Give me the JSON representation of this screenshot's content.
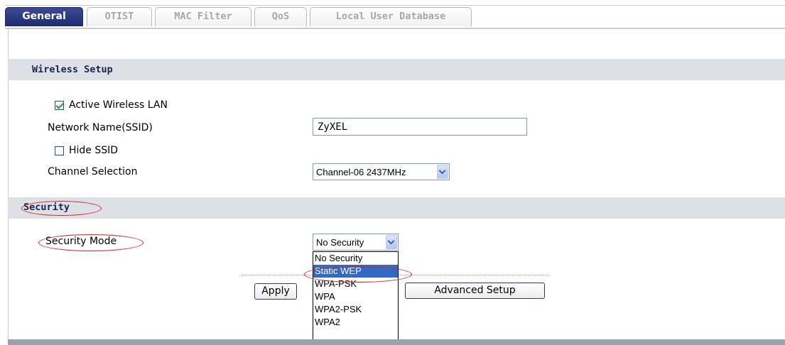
{
  "tabs": [
    {
      "label": "General",
      "active": true
    },
    {
      "label": "OTIST",
      "active": false
    },
    {
      "label": "MAC Filter",
      "active": false
    },
    {
      "label": "QoS",
      "active": false
    },
    {
      "label": "Local User Database",
      "active": false
    }
  ],
  "wireless_setup": {
    "title": "Wireless Setup",
    "active_wlan": {
      "label": "Active Wireless LAN",
      "checked": true
    },
    "ssid": {
      "label": "Network Name(SSID)",
      "value": "ZyXEL"
    },
    "hide_ssid": {
      "label": "Hide SSID",
      "checked": false
    },
    "channel": {
      "label": "Channel Selection",
      "value": "Channel-06 2437MHz"
    }
  },
  "security": {
    "title": "Security",
    "mode": {
      "label": "Security Mode",
      "value": "No Security",
      "options": [
        "No Security",
        "Static WEP",
        "WPA-PSK",
        "WPA",
        "WPA2-PSK",
        "WPA2"
      ],
      "highlighted": "Static WEP"
    }
  },
  "buttons": {
    "apply": "Apply",
    "advanced": "Advanced Setup"
  },
  "colors": {
    "active_tab": "#1e2a6c",
    "section_bar": "#dde1e5",
    "annotation": "#d62020",
    "highlight": "#316ac5"
  }
}
